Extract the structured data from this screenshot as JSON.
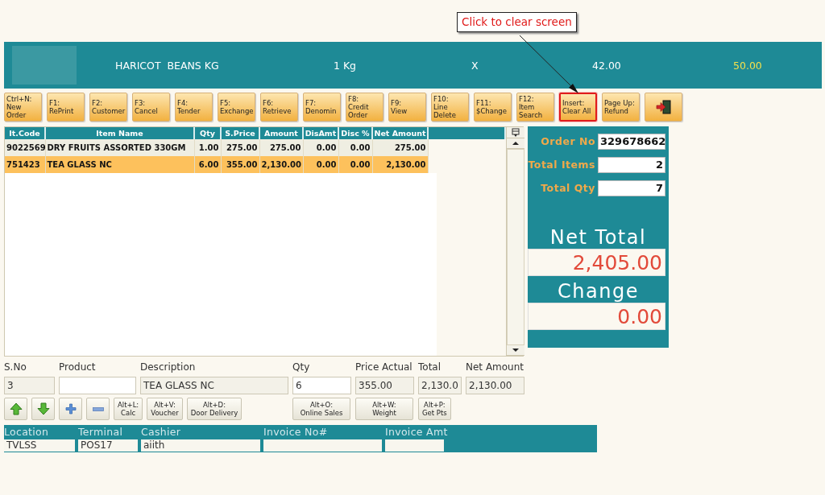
{
  "callout": {
    "text": "Click to clear screen"
  },
  "banner": {
    "product": "HARICOT  BEANS KG",
    "unit": "1 Kg",
    "multiplier": "X",
    "price": "42.00",
    "mrp": "50.00"
  },
  "toolbar": [
    {
      "kind": "text",
      "key": "Ctrl+N:",
      "label": "New Order",
      "highlighted": false
    },
    {
      "kind": "text",
      "key": "F1:",
      "label": "RePrint",
      "highlighted": false
    },
    {
      "kind": "text",
      "key": "F2:",
      "label": "Customer",
      "highlighted": false
    },
    {
      "kind": "text",
      "key": "F3:",
      "label": "Cancel",
      "highlighted": false
    },
    {
      "kind": "text",
      "key": "F4:",
      "label": "Tender",
      "highlighted": false
    },
    {
      "kind": "text",
      "key": "F5:",
      "label": "Exchange",
      "highlighted": false
    },
    {
      "kind": "text",
      "key": "F6:",
      "label": "Retrieve",
      "highlighted": false
    },
    {
      "kind": "text",
      "key": "F7:",
      "label": "Denomin",
      "highlighted": false
    },
    {
      "kind": "text",
      "key": "F8:",
      "label": "Credit Order",
      "highlighted": false
    },
    {
      "kind": "text",
      "key": "F9:",
      "label": "View",
      "highlighted": false
    },
    {
      "kind": "text",
      "key": "F10:",
      "label": "Line Delete",
      "highlighted": false
    },
    {
      "kind": "text",
      "key": "F11:",
      "label": "$Change",
      "highlighted": false
    },
    {
      "kind": "text",
      "key": "F12:",
      "label": "Item Search",
      "highlighted": false
    },
    {
      "kind": "text",
      "key": "Insert:",
      "label": "Clear All",
      "highlighted": true
    },
    {
      "kind": "text",
      "key": "Page Up:",
      "label": "Refund",
      "highlighted": false
    },
    {
      "kind": "exit",
      "highlighted": false
    }
  ],
  "table": {
    "columns": [
      "It.Code",
      "Item Name",
      "Qty",
      "S.Price",
      "Amount",
      "DisAmt",
      "Disc %",
      "Net Amount"
    ],
    "rows": [
      {
        "cells": [
          "9022569",
          "DRY FRUITS ASSORTED 330GM",
          "1.00",
          "275.00",
          "275.00",
          "0.00",
          "0.00",
          "275.00"
        ],
        "selected": false
      },
      {
        "cells": [
          "751423",
          "TEA GLASS NC",
          "6.00",
          "355.00",
          "2,130.00",
          "0.00",
          "0.00",
          "2,130.00"
        ],
        "selected": true
      }
    ]
  },
  "totals": {
    "fields": [
      {
        "label": "Order No",
        "value": "329678662"
      },
      {
        "label": "Total Items",
        "value": "2"
      },
      {
        "label": "Total Qty",
        "value": "7"
      }
    ],
    "net_total": {
      "label": "Net Total",
      "value": "2,405.00"
    },
    "change": {
      "label": "Change",
      "value": "0.00"
    }
  },
  "entry": {
    "fields": [
      {
        "label": "S.No",
        "value": "3",
        "disabled": true
      },
      {
        "label": "Product",
        "disabled": false
      },
      {
        "label": "Description",
        "value": "TEA GLASS NC",
        "disabled": true
      },
      {
        "label": "Qty",
        "value": "6",
        "disabled": false
      },
      {
        "label": "Price Actual",
        "value": "355.00",
        "disabled": true
      },
      {
        "label": "Total",
        "value": "2,130.0",
        "disabled": true
      },
      {
        "label": "Net Amount",
        "value": "2,130.00",
        "disabled": true
      }
    ],
    "left_buttons": [
      {
        "kind": "up"
      },
      {
        "kind": "down"
      },
      {
        "kind": "plus"
      },
      {
        "kind": "minus"
      },
      {
        "kind": "text",
        "key": "Alt+L:",
        "label": "Calc"
      },
      {
        "kind": "text",
        "key": "Alt+V:",
        "label": "Voucher"
      },
      {
        "kind": "text",
        "key": "Alt+D:",
        "label": "Door Delivery"
      }
    ],
    "right_buttons": [
      {
        "kind": "text",
        "key": "Alt+O:",
        "label": "Online Sales"
      },
      {
        "kind": "text",
        "key": "Alt+W:",
        "label": "Weight"
      },
      {
        "kind": "text",
        "key": "Alt+P:",
        "label": "Get Pts"
      }
    ]
  },
  "footer": {
    "fields": [
      {
        "label": "Location",
        "value": "TVLSS"
      },
      {
        "label": "Terminal",
        "value": "POS17"
      },
      {
        "label": "Cashier",
        "value": "aiith"
      },
      {
        "label": "Invoice No#"
      },
      {
        "label": "Invoice Amt"
      }
    ]
  }
}
